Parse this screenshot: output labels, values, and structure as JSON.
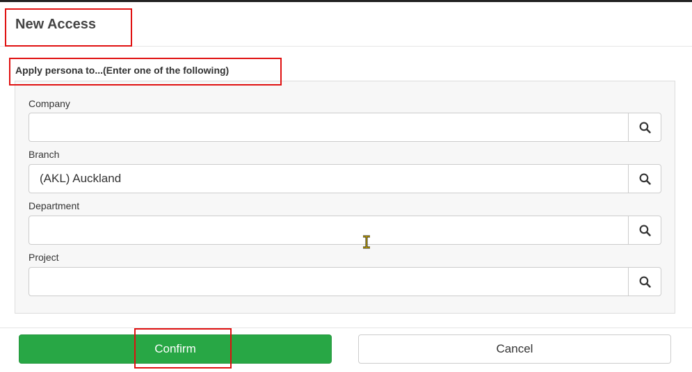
{
  "dialog": {
    "title": "New Access",
    "section_label": "Apply persona to...(Enter one of the following)"
  },
  "fields": [
    {
      "label": "Company",
      "value": "",
      "placeholder": ""
    },
    {
      "label": "Branch",
      "value": "(AKL) Auckland",
      "placeholder": ""
    },
    {
      "label": "Department",
      "value": "",
      "placeholder": ""
    },
    {
      "label": "Project",
      "value": "",
      "placeholder": ""
    }
  ],
  "buttons": {
    "confirm_label": "Confirm",
    "cancel_label": "Cancel"
  },
  "icons": {
    "lookup": "search-icon",
    "pointer": "text-cursor-icon"
  },
  "colors": {
    "confirm": "#28a745",
    "highlight": "#e01010"
  }
}
